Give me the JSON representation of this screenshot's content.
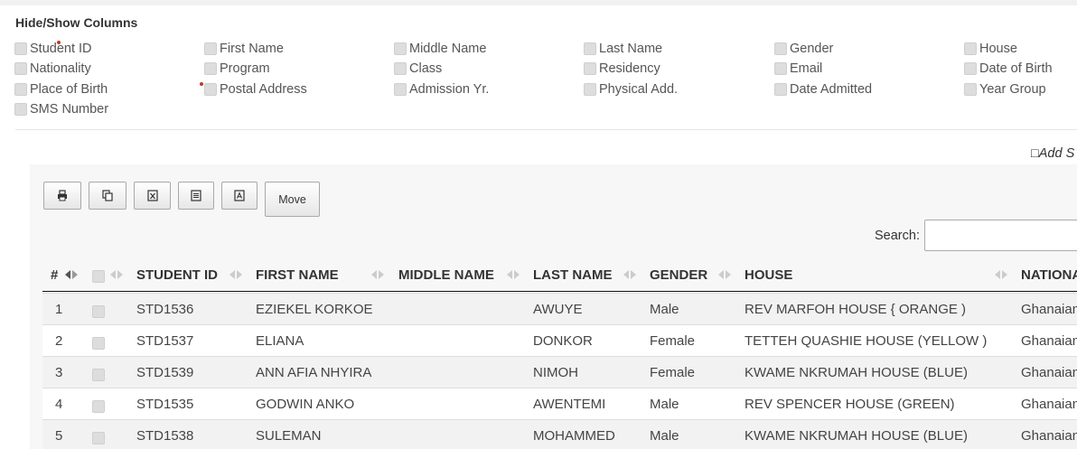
{
  "hide_show": {
    "title": "Hide/Show Columns",
    "columns": [
      "Student ID",
      "First Name",
      "Middle Name",
      "Last Name",
      "Gender",
      "House",
      "Nationality",
      "Program",
      "Class",
      "Residency",
      "Email",
      "Date of Birth",
      "Place of Birth",
      "Postal Address",
      "Admission Yr.",
      "Physical Add.",
      "Date Admitted",
      "Year Group",
      "SMS Number"
    ]
  },
  "add_link": "□Add S",
  "toolbar": {
    "print_icon": "printer-icon",
    "copy_icon": "copy-icon",
    "excel_icon": "excel-icon",
    "csv_icon": "csv-icon",
    "pdf_icon": "pdf-icon",
    "move_label": "Move"
  },
  "search": {
    "label": "Search:",
    "value": ""
  },
  "table": {
    "headers": [
      "#",
      "",
      "STUDENT ID",
      "FIRST NAME",
      "MIDDLE NAME",
      "LAST NAME",
      "GENDER",
      "HOUSE",
      "NATIONA"
    ],
    "rows": [
      [
        "1",
        "STD1536",
        "EZIEKEL KORKOE",
        "",
        "AWUYE",
        "Male",
        "REV MARFOH HOUSE { ORANGE )",
        "Ghanaian"
      ],
      [
        "2",
        "STD1537",
        "ELIANA",
        "",
        "DONKOR",
        "Female",
        "TETTEH QUASHIE HOUSE (YELLOW )",
        "Ghanaian"
      ],
      [
        "3",
        "STD1539",
        "ANN AFIA NHYIRA",
        "",
        "NIMOH",
        "Female",
        "KWAME NKRUMAH HOUSE (BLUE)",
        "Ghanaian"
      ],
      [
        "4",
        "STD1535",
        "GODWIN ANKO",
        "",
        "AWENTEMI",
        "Male",
        "REV SPENCER HOUSE (GREEN)",
        "Ghanaian"
      ],
      [
        "5",
        "STD1538",
        "SULEMAN",
        "",
        "MOHAMMED",
        "Male",
        "KWAME NKRUMAH HOUSE (BLUE)",
        "Ghanaian"
      ]
    ]
  }
}
